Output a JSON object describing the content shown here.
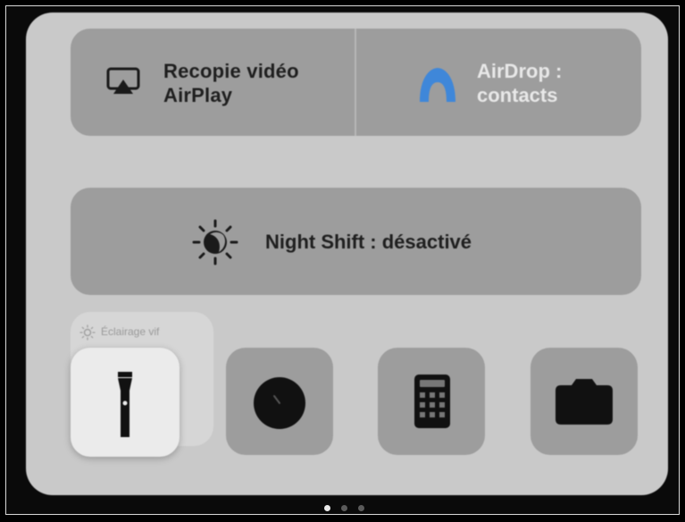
{
  "control_center": {
    "airplay": {
      "label_line1": "Recopie vidéo",
      "label_line2": "AirPlay",
      "icon": "airplay-screen-icon"
    },
    "airdrop": {
      "label_line1": "AirDrop :",
      "label_line2": "contacts",
      "icon": "airdrop-icon",
      "icon_color": "#3f87d9"
    },
    "night_shift": {
      "label": "Night Shift : désactivé",
      "icon": "night-shift-sun-icon"
    },
    "brightness_tooltip": {
      "label": "Éclairage vif",
      "icon": "sun-icon"
    },
    "shortcuts": [
      {
        "name": "flashlight",
        "icon": "flashlight-icon",
        "active": true
      },
      {
        "name": "clock",
        "icon": "clock-icon",
        "active": false
      },
      {
        "name": "calculator",
        "icon": "calculator-icon",
        "active": false
      },
      {
        "name": "camera",
        "icon": "camera-icon",
        "active": false
      }
    ],
    "page_indicator": {
      "count": 3,
      "current": 1
    }
  },
  "colors": {
    "panel_bg": "#c9c9c9",
    "tile_bg": "#9d9d9d",
    "active_tile_bg": "#ebebeb",
    "icon_dark": "#111111"
  }
}
